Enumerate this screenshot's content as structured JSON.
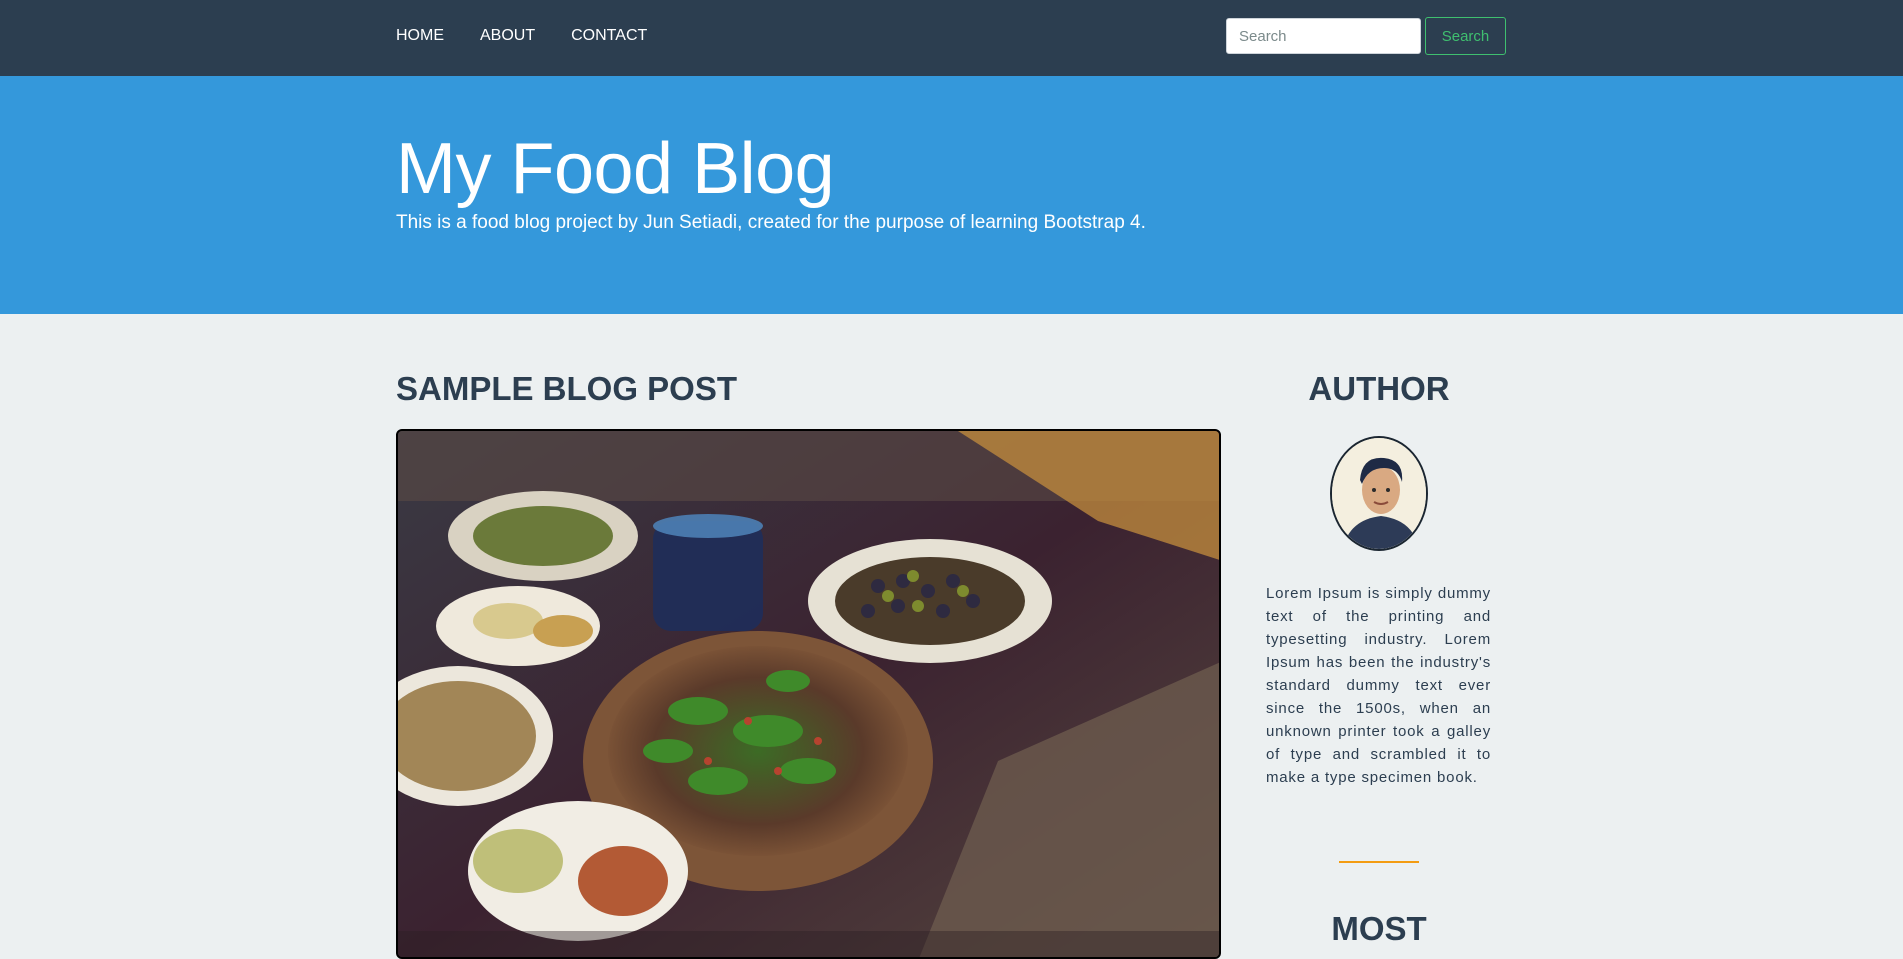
{
  "nav": {
    "links": [
      "HOME",
      "ABOUT",
      "CONTACT"
    ],
    "search_placeholder": "Search",
    "search_button": "Search"
  },
  "hero": {
    "title": "My Food Blog",
    "subtitle": "This is a food blog project by Jun Setiadi, created for the purpose of learning Bootstrap 4."
  },
  "post": {
    "heading": "SAMPLE BLOG POST"
  },
  "sidebar": {
    "author_heading": "AUTHOR",
    "bio": "Lorem Ipsum is simply dummy text of the printing and typesetting industry. Lorem Ipsum has been the industry's standard dummy text ever since the 1500s, when an unknown printer took a galley of type and scrambled it to make a type specimen book.",
    "most_heading": "MOST"
  },
  "colors": {
    "navbar": "#2c3e50",
    "hero": "#3498db",
    "page_bg": "#ecf0f1",
    "search_button": "#3fbf6f",
    "divider": "#f39c12"
  }
}
